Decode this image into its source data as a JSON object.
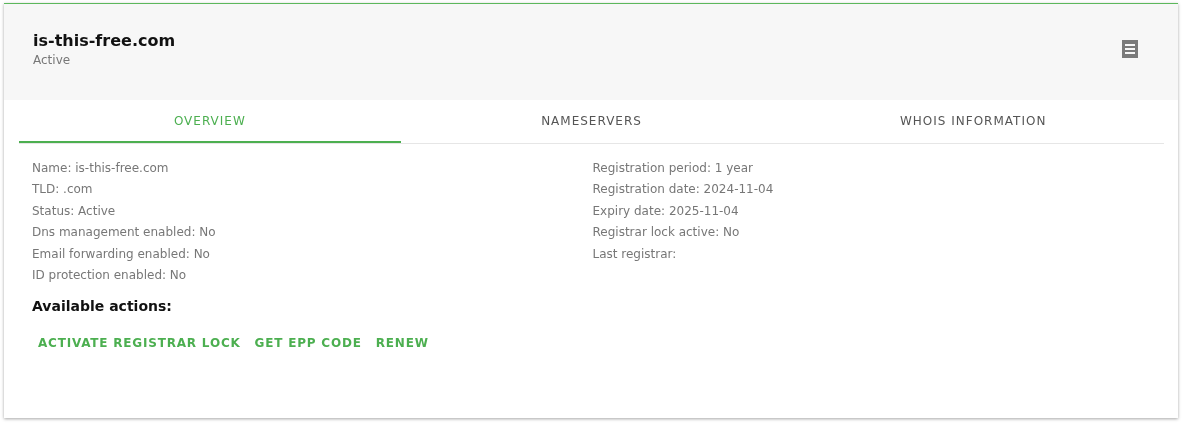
{
  "header": {
    "title": "is-this-free.com",
    "status": "Active"
  },
  "tabs": [
    {
      "label": "OVERVIEW",
      "selected": true
    },
    {
      "label": "NAMESERVERS",
      "selected": false
    },
    {
      "label": "WHOIS INFORMATION",
      "selected": false
    }
  ],
  "details_left": [
    "Name: is-this-free.com",
    "TLD: .com",
    "Status: Active",
    "Dns management enabled: No",
    "Email forwarding enabled: No",
    "ID protection enabled: No"
  ],
  "details_right": [
    "Registration period: 1 year",
    "Registration date: 2024-11-04",
    "Expiry date: 2025-11-04",
    "Registrar lock active: No",
    "Last registrar:"
  ],
  "actions_heading": "Available actions:",
  "actions": [
    "ACTIVATE REGISTRAR LOCK",
    "GET EPP CODE",
    "RENEW"
  ]
}
